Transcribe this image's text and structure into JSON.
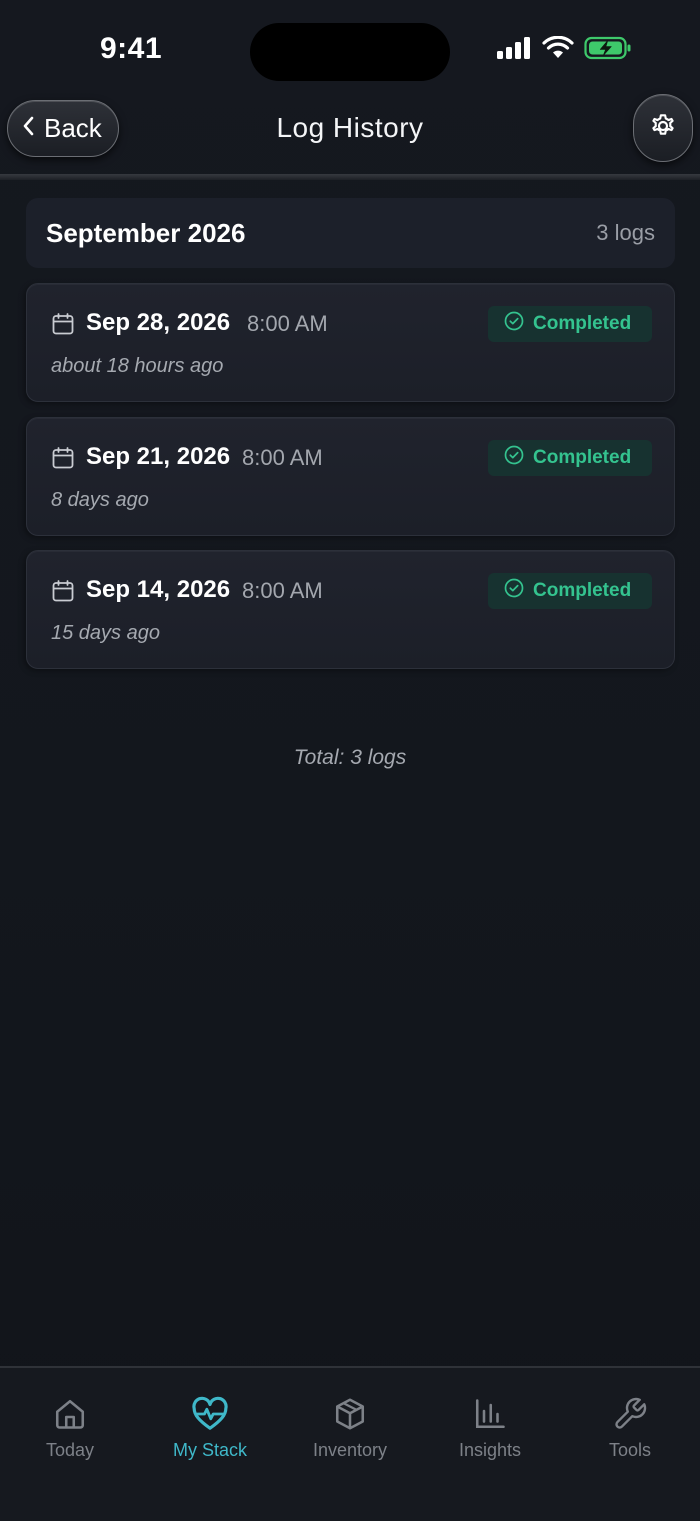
{
  "status_bar": {
    "time": "9:41"
  },
  "header": {
    "back_label": "Back",
    "title": "Log History"
  },
  "month": {
    "title": "September 2026",
    "count": "3 logs"
  },
  "logs": [
    {
      "date": "Sep 28, 2026",
      "time": "8:00 AM",
      "ago": "about 18 hours ago",
      "status": "Completed"
    },
    {
      "date": "Sep 21, 2026",
      "time": "8:00 AM",
      "ago": "8 days ago",
      "status": "Completed"
    },
    {
      "date": "Sep 14, 2026",
      "time": "8:00 AM",
      "ago": "15 days ago",
      "status": "Completed"
    }
  ],
  "total": "Total: 3 logs",
  "tabs": [
    {
      "label": "Today",
      "icon": "home-icon",
      "active": false
    },
    {
      "label": "My Stack",
      "icon": "heart-pulse-icon",
      "active": true
    },
    {
      "label": "Inventory",
      "icon": "box-icon",
      "active": false
    },
    {
      "label": "Insights",
      "icon": "bar-chart-icon",
      "active": false
    },
    {
      "label": "Tools",
      "icon": "wrench-icon",
      "active": false
    }
  ],
  "colors": {
    "background": "#13161c",
    "card": "#1e212a",
    "accent": "#3fb8c9",
    "success": "#34c38f",
    "muted_text": "#a5a9b0"
  }
}
